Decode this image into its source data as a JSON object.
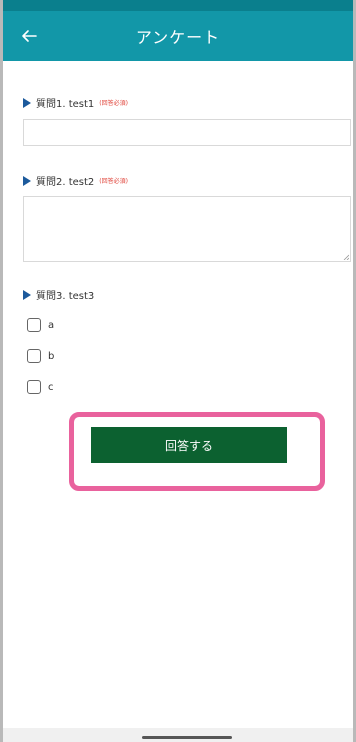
{
  "header": {
    "title": "アンケート",
    "back_icon": "arrow-left-icon"
  },
  "questions": [
    {
      "label": "質問1. test1",
      "required": "(回答必須)",
      "type": "text"
    },
    {
      "label": "質問2. test2",
      "required": "(回答必須)",
      "type": "textarea"
    },
    {
      "label": "質問3. test3",
      "type": "checkbox",
      "options": [
        "a",
        "b",
        "c"
      ]
    }
  ],
  "submit": {
    "label": "回答する"
  },
  "colors": {
    "app_bar": "#1297a8",
    "status_bar": "#0a7f8d",
    "submit_button": "#0c6130",
    "required_text": "#e0443a",
    "highlight": "#e9629d"
  }
}
